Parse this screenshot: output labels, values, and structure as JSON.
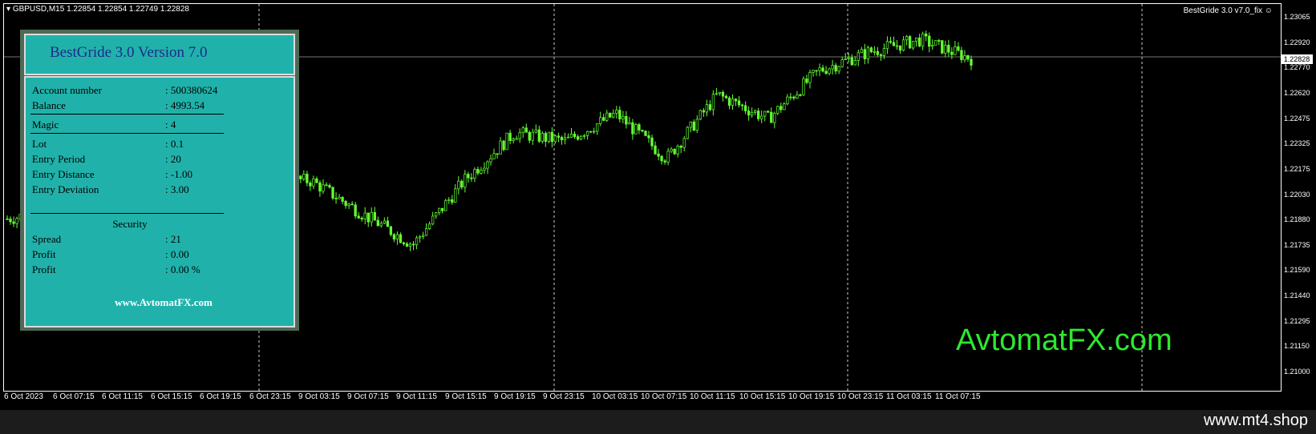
{
  "header": {
    "symbol": "GBPUSD,M15",
    "quote": "1.22854 1.22854 1.22749 1.22828",
    "ea_name": "BestGride  3.0 v7.0_fix",
    "ea_icon": "smiley-icon"
  },
  "price_axis": {
    "labels": [
      "1.23065",
      "1.22920",
      "1.22770",
      "1.22620",
      "1.22475",
      "1.22325",
      "1.22175",
      "1.22030",
      "1.21880",
      "1.21735",
      "1.21590",
      "1.21440",
      "1.21295",
      "1.21150",
      "1.21000"
    ],
    "current_price": "1.22828"
  },
  "time_axis": {
    "labels": [
      "6 Oct 2023",
      "6 Oct 07:15",
      "6 Oct 11:15",
      "6 Oct 15:15",
      "6 Oct 19:15",
      "6 Oct 23:15",
      "9 Oct 03:15",
      "9 Oct 07:15",
      "9 Oct 11:15",
      "9 Oct 15:15",
      "9 Oct 19:15",
      "9 Oct 23:15",
      "10 Oct 03:15",
      "10 Oct 07:15",
      "10 Oct 11:15",
      "10 Oct 15:15",
      "10 Oct 19:15",
      "10 Oct 23:15",
      "11 Oct 03:15",
      "11 Oct 07:15"
    ]
  },
  "colors": {
    "candle": "#66ff33",
    "background": "#000000",
    "panel_bg": "#20b2aa",
    "panel_title": "#1f2a8c",
    "watermark": "#2ee82e"
  },
  "chart_data": {
    "type": "candlestick",
    "series": [
      {
        "x": "6 Oct 2023",
        "close": 1.219
      },
      {
        "x": "6 Oct 07:15",
        "close": 1.2195
      },
      {
        "x": "6 Oct 11:15",
        "close": 1.2205
      },
      {
        "x": "6 Oct 15:15",
        "close": 1.214
      },
      {
        "x": "6 Oct 19:15",
        "close": 1.2195
      },
      {
        "x": "6 Oct 23:15",
        "close": 1.2214
      },
      {
        "x": "9 Oct 03:15",
        "close": 1.2212
      },
      {
        "x": "9 Oct 07:15",
        "close": 1.2193
      },
      {
        "x": "9 Oct 11:15",
        "close": 1.2175
      },
      {
        "x": "9 Oct 15:15",
        "close": 1.2212
      },
      {
        "x": "9 Oct 19:15",
        "close": 1.224
      },
      {
        "x": "9 Oct 23:15",
        "close": 1.2235
      },
      {
        "x": "10 Oct 03:15",
        "close": 1.2251
      },
      {
        "x": "10 Oct 07:15",
        "close": 1.2225
      },
      {
        "x": "10 Oct 11:15",
        "close": 1.2262
      },
      {
        "x": "10 Oct 15:15",
        "close": 1.2248
      },
      {
        "x": "10 Oct 19:15",
        "close": 1.2276
      },
      {
        "x": "10 Oct 23:15",
        "close": 1.2287
      },
      {
        "x": "11 Oct 03:15",
        "close": 1.2294
      },
      {
        "x": "11 Oct 07:15",
        "close": 1.2283
      }
    ],
    "ylim": [
      1.21,
      1.231
    ],
    "grid": "vertical dashed"
  },
  "panel": {
    "title": "BestGride 3.0 Version 7.0",
    "rows": [
      {
        "k": "Account number",
        "v": ": 500380624"
      },
      {
        "k": "Balance",
        "v": ": 4993.54"
      },
      {
        "k": "Magic",
        "v": ": 4"
      },
      {
        "k": "Lot",
        "v": ": 0.1"
      },
      {
        "k": "Entry Period",
        "v": ": 20"
      },
      {
        "k": "Entry Distance",
        "v": ": -1.00"
      },
      {
        "k": "Entry Deviation",
        "v": ": 3.00"
      }
    ],
    "security_title": "Security",
    "security_rows": [
      {
        "k": "Spread",
        "v": ": 21"
      },
      {
        "k": "Profit",
        "v": ": 0.00"
      },
      {
        "k": "Profit",
        "v": ": 0.00  %"
      }
    ],
    "site": "www.AvtomatFX.com"
  },
  "watermark": "AvtomatFX.com",
  "footer": {
    "text": "www.mt4.shop"
  }
}
